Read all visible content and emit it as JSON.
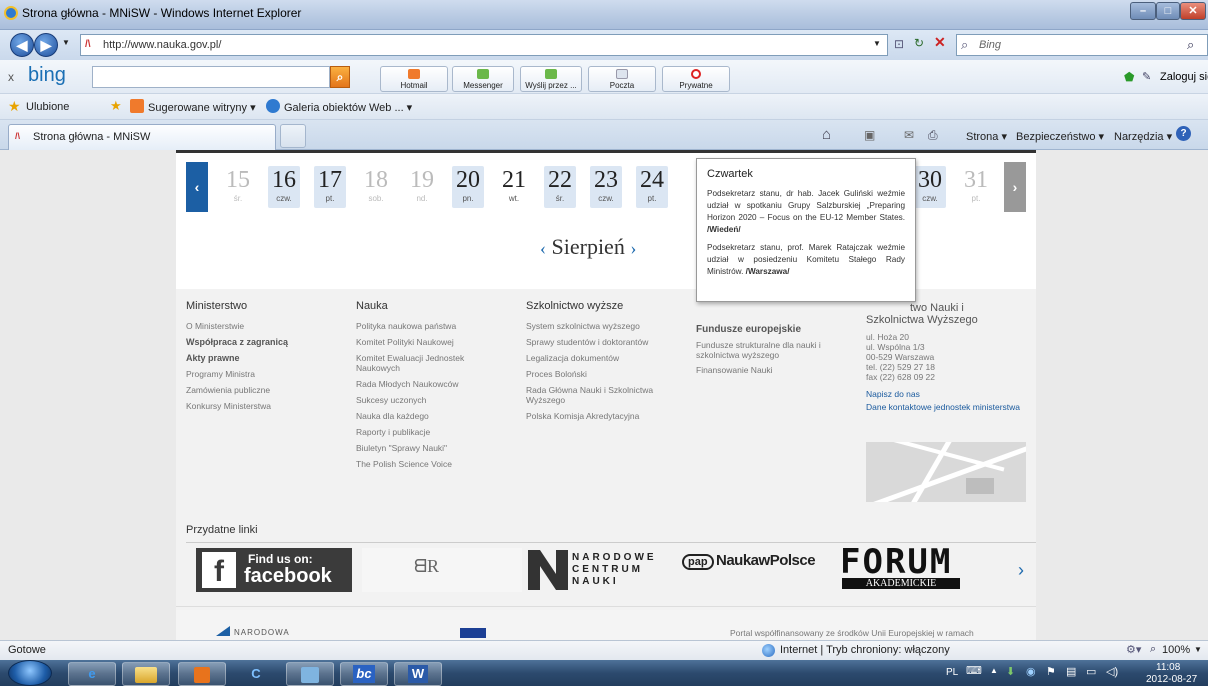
{
  "window": {
    "title": "Strona główna - MNiSW - Windows Internet Explorer"
  },
  "address": {
    "url": "http://www.nauka.gov.pl/",
    "search_placeholder": "Bing"
  },
  "bingbar": {
    "brand": "bing",
    "buttons": [
      "Hotmail",
      "Messenger",
      "Wyślij przez ...",
      "Poczta",
      "Prywatne"
    ],
    "login": "Zaloguj się"
  },
  "favorites": {
    "label": "Ulubione",
    "items": [
      "Sugerowane witryny ▾",
      "Galeria obiektów Web ... ▾"
    ]
  },
  "tabs": {
    "active": "Strona główna - MNiSW"
  },
  "commandbar": {
    "items": [
      "Strona ▾",
      "Bezpieczeństwo ▾",
      "Narzędzia ▾"
    ]
  },
  "calendar": {
    "days": [
      {
        "n": "15",
        "d": "śr.",
        "state": "off"
      },
      {
        "n": "16",
        "d": "czw.",
        "state": "on"
      },
      {
        "n": "17",
        "d": "pt.",
        "state": "on"
      },
      {
        "n": "18",
        "d": "sob.",
        "state": "off"
      },
      {
        "n": "19",
        "d": "nd.",
        "state": "off"
      },
      {
        "n": "20",
        "d": "pn.",
        "state": "on"
      },
      {
        "n": "21",
        "d": "wt.",
        "state": "plain"
      },
      {
        "n": "22",
        "d": "śr.",
        "state": "on"
      },
      {
        "n": "23",
        "d": "czw.",
        "state": "on"
      },
      {
        "n": "24",
        "d": "pt.",
        "state": "on"
      },
      {
        "n": "30",
        "d": "czw.",
        "state": "on"
      },
      {
        "n": "31",
        "d": "pt.",
        "state": "off"
      }
    ],
    "month": "Sierpień",
    "prev": "‹",
    "next": "›"
  },
  "tooltip": {
    "title": "Czwartek",
    "p1": "Podsekretarz stanu, dr hab. Jacek Guliński weźmie udział w spotkaniu Grupy Salzburskiej „Preparing Horizon 2020 – Focus on the EU-12 Member States. /Wiedeń/",
    "p2": "Podsekretarz stanu, prof. Marek Ratajczak weźmie udział w posiedzeniu Komitetu Stałego Rady Ministrów. /Warszawa/"
  },
  "footer": {
    "ministerstwo": {
      "title": "Ministerstwo",
      "links": [
        "O Ministerstwie",
        "Współpraca z zagranicą",
        "Akty prawne",
        "Programy Ministra",
        "Zamówienia publiczne",
        "Konkursy Ministerstwa"
      ]
    },
    "nauka": {
      "title": "Nauka",
      "links": [
        "Polityka naukowa państwa",
        "Komitet Polityki Naukowej",
        "Komitet Ewaluacji Jednostek Naukowych",
        "Rada Młodych Naukowców",
        "Sukcesy uczonych",
        "Nauka dla każdego",
        "Raporty i publikacje",
        "Biuletyn \"Sprawy Nauki\"",
        "The Polish Science Voice"
      ]
    },
    "szkolnictwo": {
      "title": "Szkolnictwo wyższe",
      "links": [
        "System szkolnictwa wyższego",
        "Sprawy studentów i doktorantów",
        "Legalizacja dokumentów",
        "Proces Boloński",
        "Rada Główna Nauki i Szkolnictwa Wyższego",
        "Polska Komisja Akredytacyjna"
      ]
    },
    "fundusze": {
      "title": "Fundusze europejskie",
      "links": [
        "Fundusze strukturalne dla nauki i szkolnictwa wyższego",
        "Finansowanie Nauki"
      ]
    },
    "kontakt": {
      "title_line1": "two Nauki i",
      "title_line2": "Szkolnictwa Wyższego",
      "address": [
        "ul. Hoża 20",
        "ul. Wspólna 1/3",
        "00-529 Warszawa",
        "tel. (22) 529 27 18",
        "fax (22) 628 09 22"
      ],
      "write": "Napisz do nas",
      "contacts": "Dane kontaktowe jednostek ministerstwa"
    }
  },
  "useful": {
    "title": "Przydatne linki",
    "logos": {
      "fb1": "Find us on:",
      "fb2": "facebook",
      "ncn1": "NARODOWE",
      "ncn2": "CENTRUM",
      "ncn3": "NAUKI",
      "pap": "pap",
      "nwp": "NaukawPolsce",
      "forum": "FORUM",
      "forum2": "AKADEMICKIE"
    }
  },
  "bottom": {
    "left": "NARODOWA",
    "right": "Portal współfinansowany ze środków Unii Europejskiej w ramach"
  },
  "statusbar": {
    "left": "Gotowe",
    "zone": "Internet | Tryb chroniony: włączony",
    "zoom": "100%"
  },
  "taskbar": {
    "lang": "PL",
    "time": "11:08",
    "date": "2012-08-27"
  }
}
